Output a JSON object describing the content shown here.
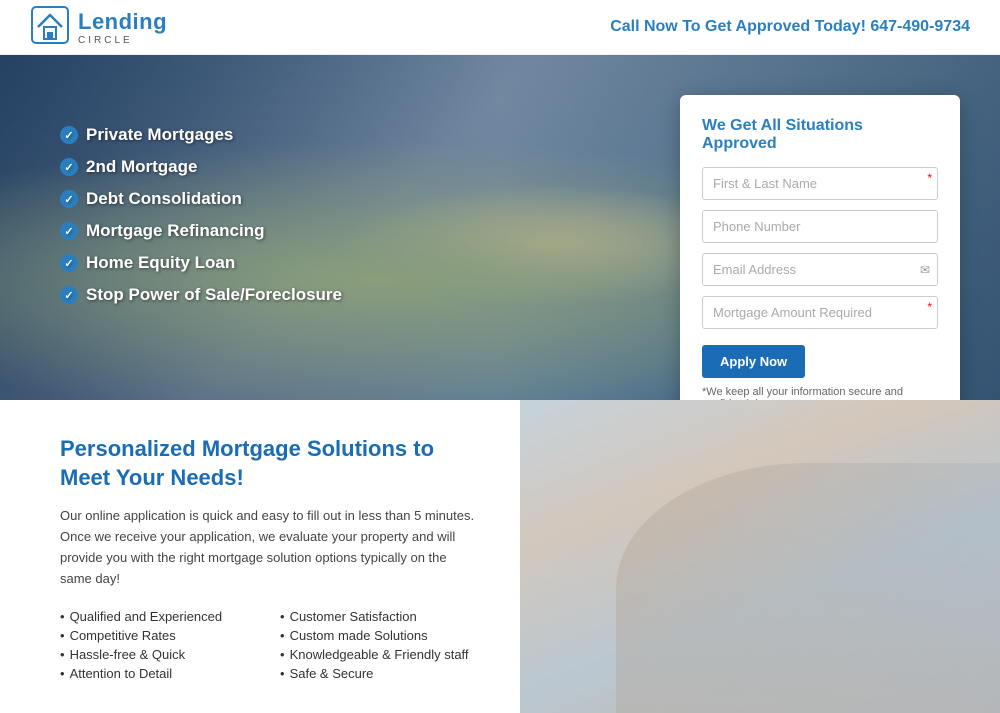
{
  "header": {
    "logo_lending": "Lending",
    "logo_circle": "CIRCLE",
    "cta_text": "Call Now To Get Approved Today!",
    "cta_phone": "647-490-9734"
  },
  "hero": {
    "list_items": [
      "Private Mortgages",
      "2nd Mortgage",
      "Debt Consolidation",
      "Mortgage Refinancing",
      "Home Equity Loan",
      "Stop Power of Sale/Foreclosure"
    ],
    "form": {
      "title": "We Get All Situations Approved",
      "field_name_placeholder": "First & Last Name",
      "field_phone_placeholder": "Phone Number",
      "field_email_placeholder": "Email Address",
      "field_amount_placeholder": "Mortgage Amount Required",
      "apply_button": "Apply Now",
      "privacy_text": "*We keep all your information secure and confidential."
    }
  },
  "section2": {
    "heading_line1": "Personalized Mortgage Solutions to",
    "heading_line2": "Meet Your Needs!",
    "description": "Our online application is quick and easy to fill out in less than 5 minutes. Once we receive your application, we evaluate your property and will provide you with the right mortgage solution options typically on the same day!",
    "features_col1": [
      "Qualified and Experienced",
      "Competitive Rates",
      "Hassle-free & Quick",
      "Attention to Detail"
    ],
    "features_col2": [
      "Customer Satisfaction",
      "Custom made Solutions",
      "Knowledgeable & Friendly staff",
      "Safe & Secure"
    ]
  }
}
